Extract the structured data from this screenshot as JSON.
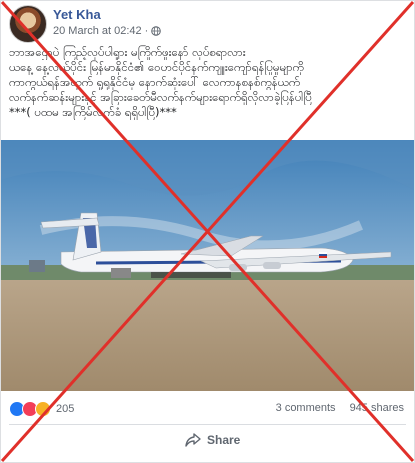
{
  "post": {
    "author": "Yet Kha",
    "timestamp": "20 March at 02:42",
    "privacy_icon": "globe-icon",
    "text_lines": [
      "ဘာအဌောပဲ ကြည့်လုပ်ပါရှုား မကြိုက်ဖူးနော် လုပ်စရာလား",
      "ယနေ့ နေ့လယ်ပိုင်း မြန်မာနိုင်ငံ၏ ဝေဟင်ပိုင်နက်ကျူးကျော်ရန်ပြုမူမျာကို",
      "ကာကွယ်ရန်အတွက် ရှုရုနိုင်ငံမှ နောက်ဆုံးပေါ် လေကာနစနစ်ကွန်ယက်",
      "လက်နက်ဆန်းများနှင့် အခြားခေတ်မီလက်နက်များရောက်ရှိလိုလာခဲ့ပြန်ပါပြီ",
      "***( ပထမ အကြိမ်လက်ခံ ရရှိပါပြီ)***"
    ]
  },
  "engagement": {
    "reaction_count": "205",
    "comments": "3 comments",
    "shares": "945 shares",
    "share_label": "Share"
  },
  "colors": {
    "accent": "#385898",
    "overlay_x": "#e0302a"
  }
}
